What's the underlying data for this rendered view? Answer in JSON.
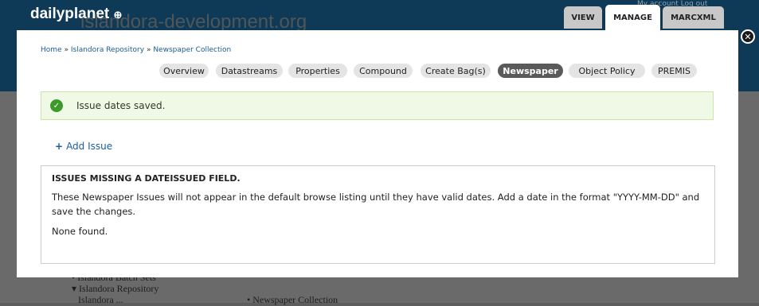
{
  "site": {
    "name": "dailyplanet",
    "url": "islandora-development.org",
    "user_links": "My account   Log out"
  },
  "top_tabs": [
    {
      "label": "VIEW"
    },
    {
      "label": "MANAGE"
    },
    {
      "label": "MARCXML"
    }
  ],
  "background": {
    "nav_items": [
      "Islandora Batch Sets",
      "Islandora Repository",
      "Islandora ..."
    ],
    "crumb": "Newspaper Collection"
  },
  "modal": {
    "breadcrumb": [
      "Home",
      "Islandora Repository",
      "Newspaper Collection"
    ],
    "breadcrumb_sep": "»",
    "subtabs": [
      "Overview",
      "Datastreams",
      "Properties",
      "Compound",
      "Create Bag(s)",
      "Newspaper",
      "Object Policy",
      "PREMIS"
    ],
    "active_subtab": "Newspaper",
    "status_message": "Issue dates saved.",
    "add_issue_label": "Add Issue",
    "issues": {
      "title": "ISSUES MISSING A DATEISSUED FIELD.",
      "description": "These Newspaper Issues will not appear in the default browse listing until they have valid dates. Add a date in the format \"YYYY-MM-DD\" and save the changes.",
      "none_found": "None found."
    }
  }
}
